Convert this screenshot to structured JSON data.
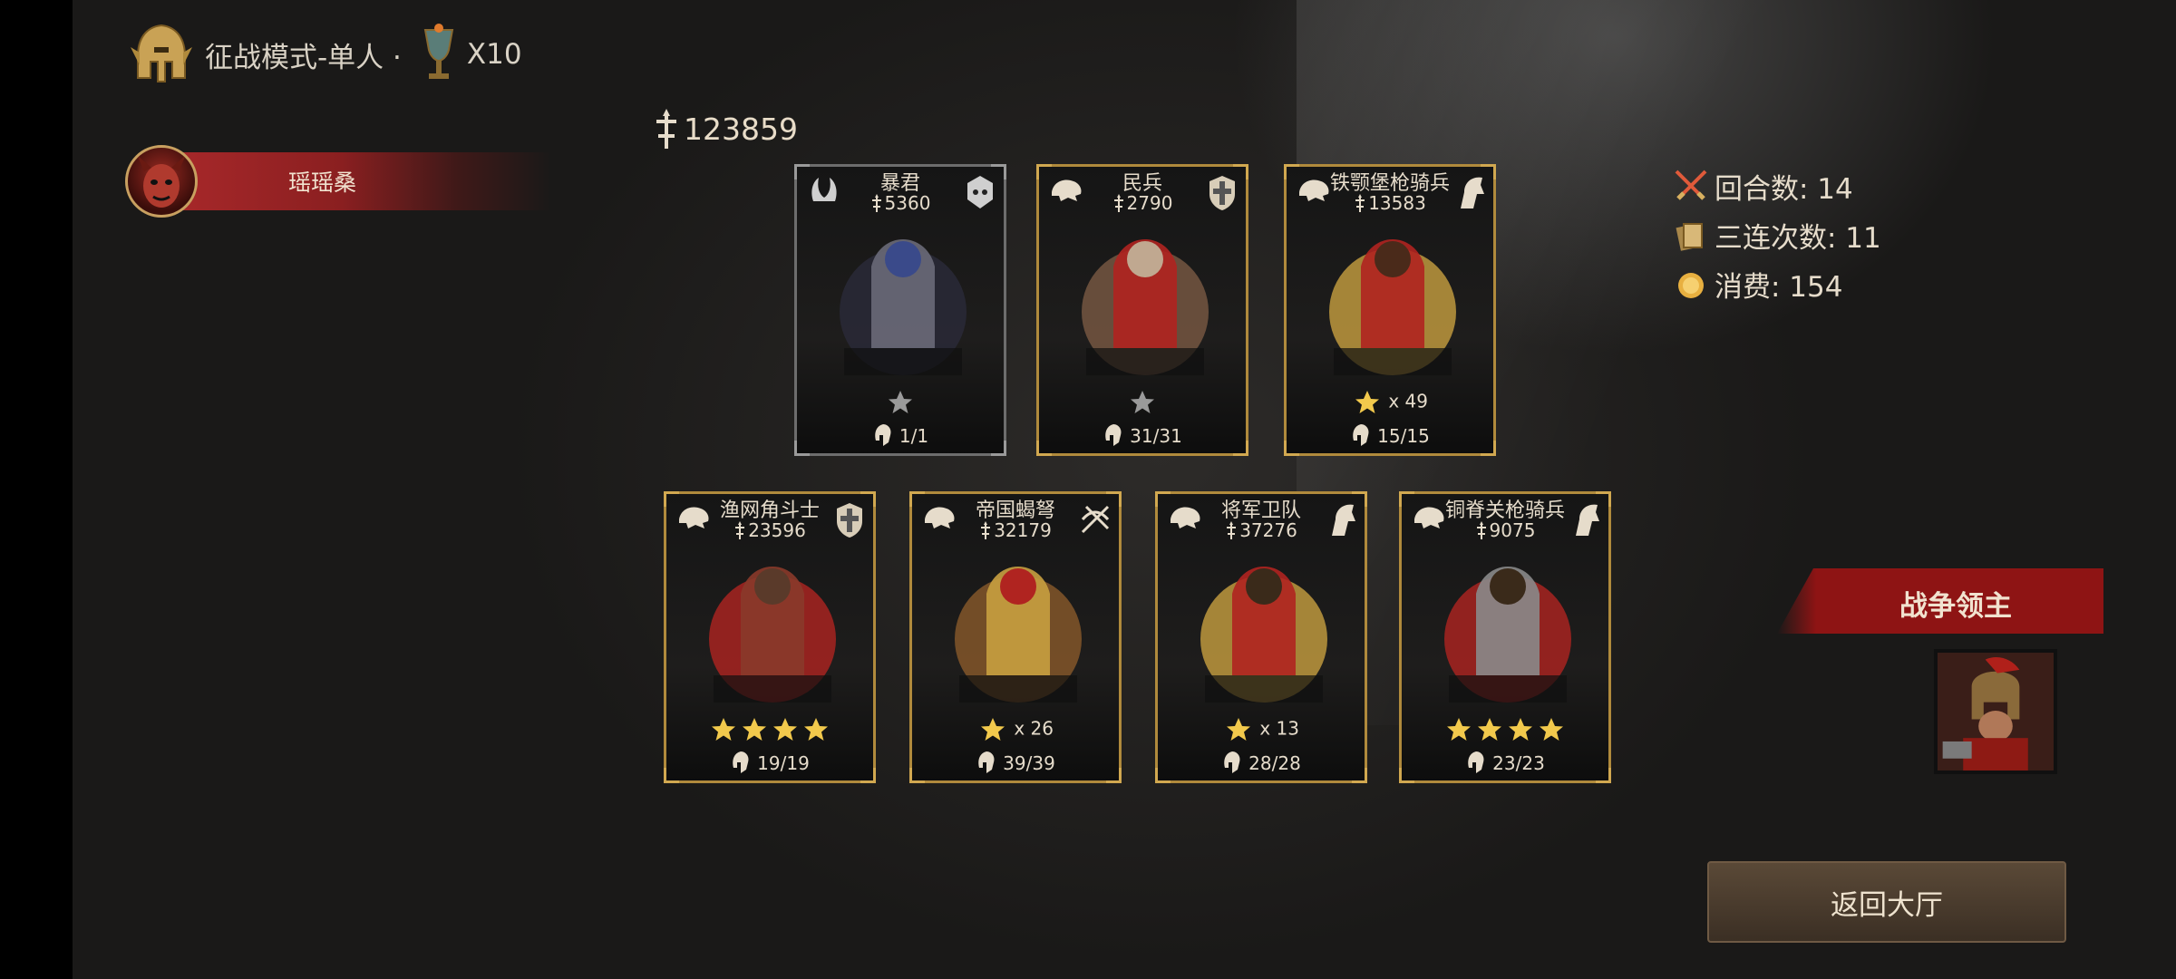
{
  "header": {
    "mode_title": "征战模式-单人 ·",
    "trophy_count": "X10"
  },
  "player": {
    "name": "瑶瑶桑"
  },
  "total_power": "123859",
  "cards": [
    {
      "name": "暴君",
      "power": "5360",
      "stars_shown": 1,
      "star_color": "gray",
      "star_multiplier": "",
      "count": "1/1",
      "frame": "gray",
      "type_icon": "horns-icon",
      "class_icon": "skull-badge-icon"
    },
    {
      "name": "民兵",
      "power": "2790",
      "stars_shown": 1,
      "star_color": "gray",
      "star_multiplier": "",
      "count": "31/31",
      "frame": "gold",
      "type_icon": "lion-icon",
      "class_icon": "shield-cross-icon"
    },
    {
      "name": "铁颚堡枪骑兵",
      "power": "13583",
      "stars_shown": 1,
      "star_color": "gold",
      "star_multiplier": "x 49",
      "count": "15/15",
      "frame": "gold",
      "type_icon": "lion-icon",
      "class_icon": "horse-head-icon"
    },
    {
      "name": "渔网角斗士",
      "power": "23596",
      "stars_shown": 4,
      "star_color": "gold",
      "star_multiplier": "",
      "count": "19/19",
      "frame": "gold",
      "type_icon": "lion-icon",
      "class_icon": "shield-cross-icon"
    },
    {
      "name": "帝国蝎弩",
      "power": "32179",
      "stars_shown": 1,
      "star_color": "gold",
      "star_multiplier": "x 26",
      "count": "39/39",
      "frame": "gold",
      "type_icon": "lion-icon",
      "class_icon": "ballista-icon"
    },
    {
      "name": "将军卫队",
      "power": "37276",
      "stars_shown": 1,
      "star_color": "gold",
      "star_multiplier": "x 13",
      "count": "28/28",
      "frame": "gold",
      "type_icon": "lion-icon",
      "class_icon": "horse-head-icon"
    },
    {
      "name": "铜脊关枪骑兵",
      "power": "9075",
      "stars_shown": 4,
      "star_color": "gold",
      "star_multiplier": "",
      "count": "23/23",
      "frame": "gold",
      "type_icon": "lion-icon",
      "class_icon": "horse-head-icon"
    }
  ],
  "stats": {
    "rounds": "回合数: 14",
    "triples": "三连次数: 11",
    "cost": "消费: 154"
  },
  "lord": {
    "title": "战争领主"
  },
  "back_button": "返回大厅",
  "colors": {
    "gold_frame": "#b08a3c",
    "gray_frame": "#6d6d6d",
    "banner_red": "#8e1414",
    "star_gold": "#f2c94c",
    "star_gray": "#9a9a9a"
  }
}
